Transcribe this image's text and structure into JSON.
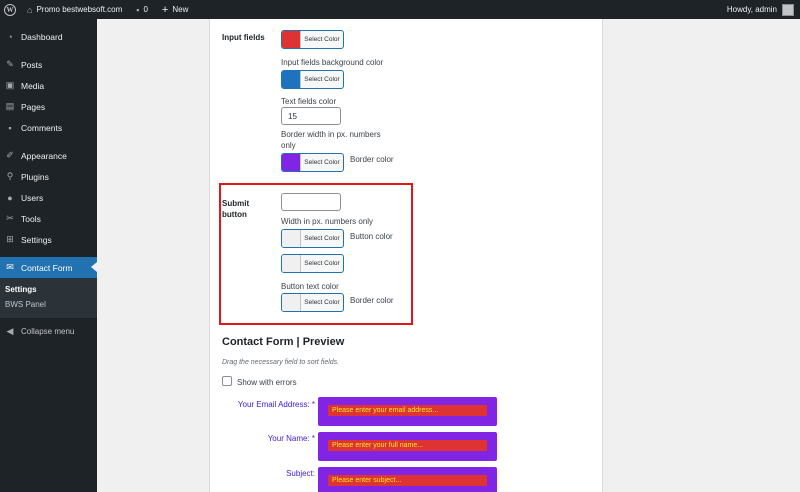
{
  "admin_bar": {
    "site_name": "Promo bestwebsoft.com",
    "comments_count": "0",
    "new_label": "New",
    "greeting": "Howdy, admin"
  },
  "sidebar": {
    "items": [
      {
        "label": "Dashboard",
        "icon": "dashboard-icon"
      },
      {
        "label": "Posts",
        "icon": "pin-icon"
      },
      {
        "label": "Media",
        "icon": "media-icon"
      },
      {
        "label": "Pages",
        "icon": "pages-icon"
      },
      {
        "label": "Comments",
        "icon": "comment-icon"
      },
      {
        "label": "Appearance",
        "icon": "brush-icon"
      },
      {
        "label": "Plugins",
        "icon": "plugin-icon"
      },
      {
        "label": "Users",
        "icon": "user-icon"
      },
      {
        "label": "Tools",
        "icon": "wrench-icon"
      },
      {
        "label": "Settings",
        "icon": "settings-icon"
      },
      {
        "label": "Contact Form",
        "icon": "mail-icon"
      }
    ],
    "submenu": [
      "Settings",
      "BWS Panel"
    ],
    "collapse_label": "Collapse menu"
  },
  "input_fields": {
    "section_label": "Input fields",
    "select_color": "Select Color",
    "bg_color_label": "Input fields background color",
    "text_color_label": "Text fields color",
    "border_width_value": "15",
    "border_width_label": "Border width in px. numbers only",
    "border_color_label": "Border color",
    "colors": {
      "first": "#dd3333",
      "second": "#1e73be",
      "border": "#8224e3"
    }
  },
  "submit_button": {
    "section_label": "Submit button",
    "width_value": "",
    "width_label": "Width in px. numbers only",
    "button_color_label": "Button color",
    "button_text_color_label": "Button text color",
    "border_color_label": "Border color",
    "select_color": "Select Color"
  },
  "preview": {
    "title": "Contact Form | Preview",
    "hint": "Drag the necessary field to sort fields.",
    "show_errors_label": "Show with errors",
    "fields": [
      {
        "label": "Your Email Address: *",
        "placeholder": "Please enter your email address..."
      },
      {
        "label": "Your Name: *",
        "placeholder": "Please enter your full name..."
      },
      {
        "label": "Subject:",
        "placeholder": "Please enter subject..."
      }
    ],
    "colors": {
      "label": "#3c1bd8",
      "field_bg": "#8224e3",
      "input_bg": "#dd3333",
      "input_text": "#eeee22"
    }
  }
}
